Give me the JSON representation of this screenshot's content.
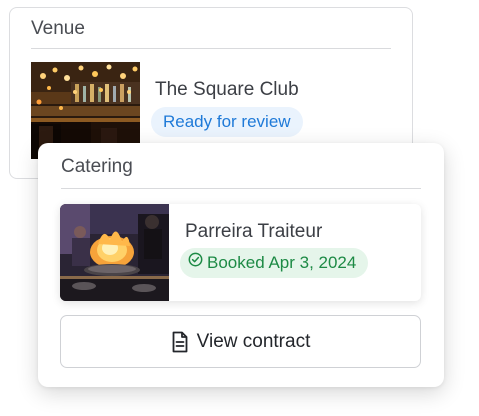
{
  "venue": {
    "section_title": "Venue",
    "name": "The Square Club",
    "status": "Ready for review",
    "photo_icon": "bar-interior-photo"
  },
  "catering": {
    "section_title": "Catering",
    "vendor_name": "Parreira Traiteur",
    "status": "Booked Apr 3, 2024",
    "status_icon": "check-circle-icon",
    "photo_icon": "chef-flambe-photo",
    "contract_button_label": "View contract",
    "contract_button_icon": "document-icon"
  },
  "colors": {
    "review_text": "#1f7ad8",
    "review_bg": "#eaf3fd",
    "booked_text": "#1d8a45",
    "booked_bg": "#e5f5ea"
  }
}
